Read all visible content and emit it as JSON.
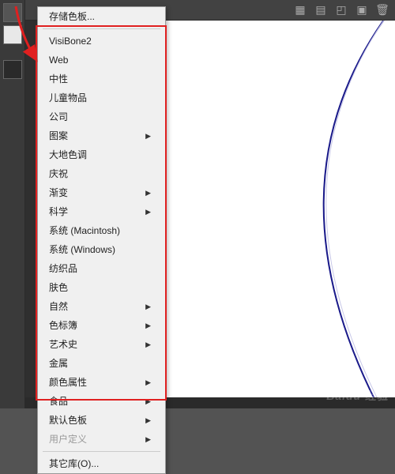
{
  "menu": {
    "save": "存储色板...",
    "items": [
      {
        "label": "VisiBone2",
        "sub": false
      },
      {
        "label": "Web",
        "sub": false
      },
      {
        "label": "中性",
        "sub": false
      },
      {
        "label": "儿童物品",
        "sub": false
      },
      {
        "label": "公司",
        "sub": false
      },
      {
        "label": "图案",
        "sub": true
      },
      {
        "label": "大地色调",
        "sub": false
      },
      {
        "label": "庆祝",
        "sub": false
      },
      {
        "label": "渐变",
        "sub": true
      },
      {
        "label": "科学",
        "sub": true
      },
      {
        "label": "系统 (Macintosh)",
        "sub": false
      },
      {
        "label": "系统 (Windows)",
        "sub": false
      },
      {
        "label": "纺织品",
        "sub": false
      },
      {
        "label": "肤色",
        "sub": false
      },
      {
        "label": "自然",
        "sub": true
      },
      {
        "label": "色标簿",
        "sub": true
      },
      {
        "label": "艺术史",
        "sub": true
      },
      {
        "label": "金属",
        "sub": false
      },
      {
        "label": "颜色属性",
        "sub": true
      },
      {
        "label": "食品",
        "sub": true
      },
      {
        "label": "默认色板",
        "sub": true
      },
      {
        "label": "用户定义",
        "sub": true,
        "disabled": true
      }
    ],
    "other": "其它库(O)..."
  },
  "watermark": "Baidu 经验"
}
